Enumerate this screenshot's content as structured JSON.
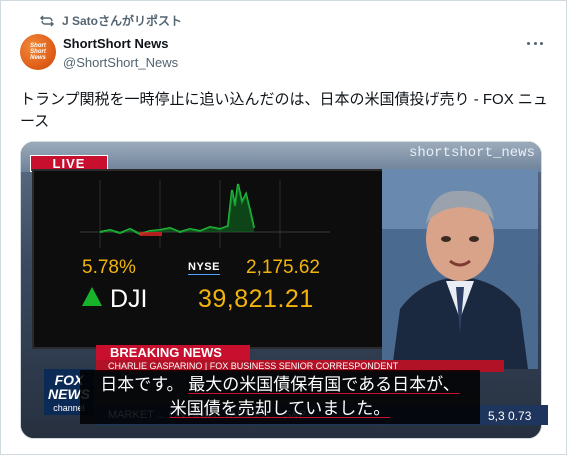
{
  "repost": {
    "text": "J Satoさんがリポスト"
  },
  "author": {
    "avatar_text": [
      "Short",
      "Short",
      "News"
    ],
    "display_name": "ShortShort News",
    "handle": "@ShortShort_News"
  },
  "tweet": {
    "text": "トランプ関税を一時停止に追い込んだのは、日本の米国債投げ売り - FOX ニュース"
  },
  "media": {
    "live_label": "LIVE",
    "watermark": "shortshort_news",
    "stock": {
      "pct_change": "5.78%",
      "nyse_label": "NYSE",
      "nyse_value": "2,175.62",
      "dji_label": "DJI",
      "dji_value": "39,821.21"
    },
    "breaking_label": "BREAKING NEWS",
    "breaking_strip": "CHARLIE GASPARINO | FOX BUSINESS SENIOR CORRESPONDENT",
    "ticker": "MARKET ... ON SOME TARIFFS ... S&P",
    "ticker_value": "5,3 0.73",
    "fox_logo": {
      "line1": "FOX",
      "line2": "NEWS",
      "line3": "channel"
    },
    "subtitle": {
      "line1_a": "日本です。",
      "line1_b": "最大の米国債保有国である日本が、",
      "line2": "米国債を売却していました。"
    }
  },
  "colors": {
    "accent_red": "#c8102e",
    "ticker_yellow": "#f2b40c",
    "gain_green": "#17b42b"
  }
}
